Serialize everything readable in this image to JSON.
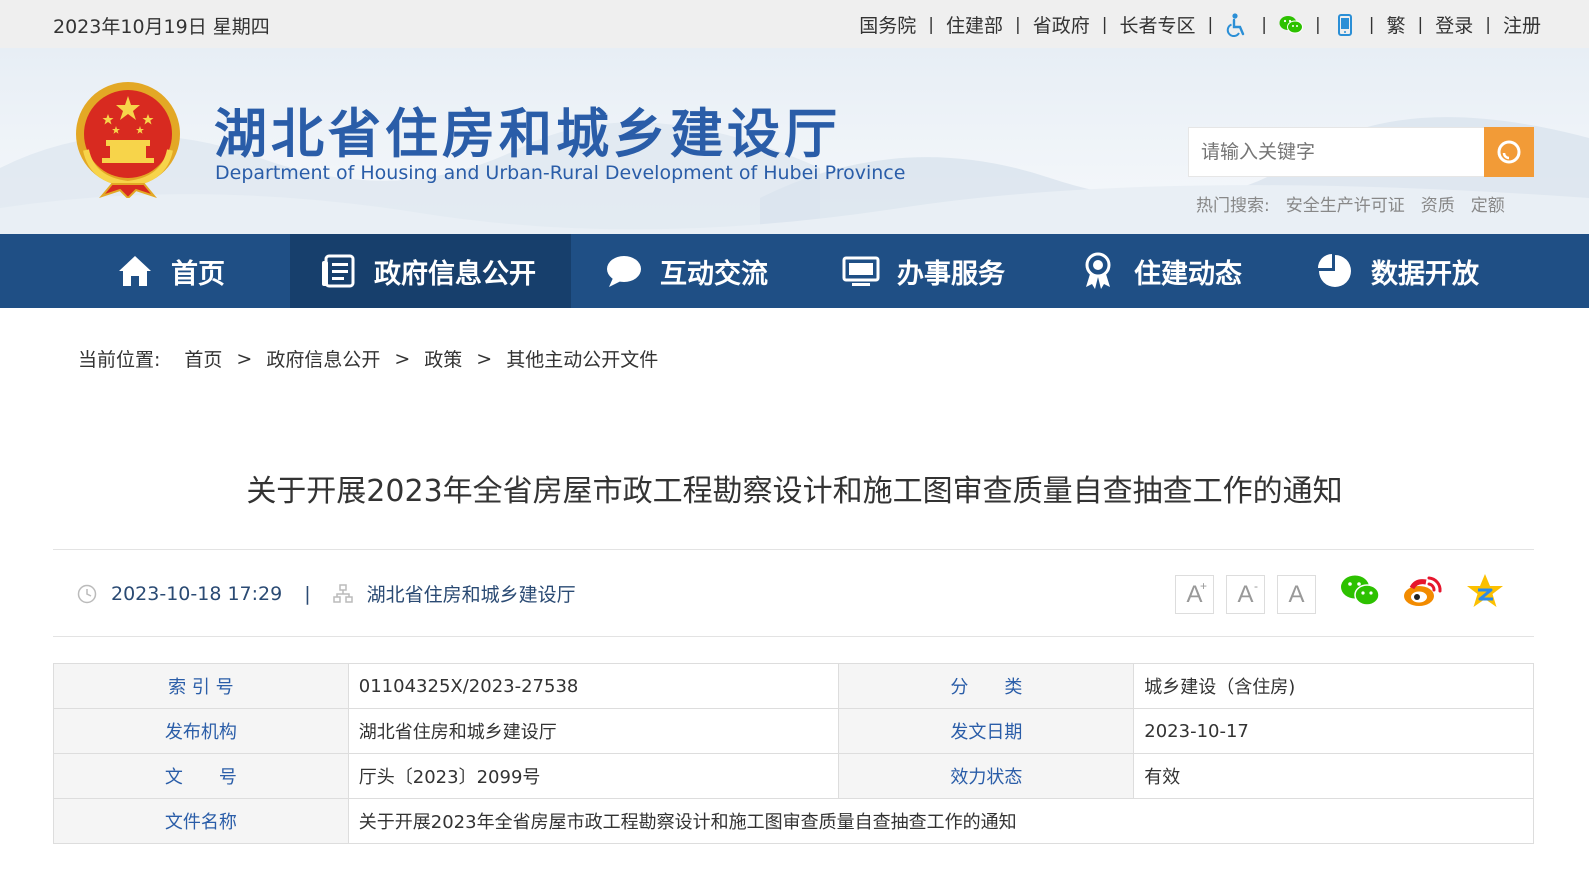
{
  "topbar": {
    "date": "2023年10月19日 星期四",
    "links": [
      "国务院",
      "住建部",
      "省政府",
      "长者专区"
    ],
    "right_links": [
      "繁",
      "登录",
      "注册"
    ],
    "icons": [
      "accessibility-icon",
      "wechat-icon",
      "mobile-icon"
    ]
  },
  "header": {
    "title": "湖北省住房和城乡建设厅",
    "subtitle": "Department of Housing and Urban-Rural Development of Hubei Province",
    "search_placeholder": "请输入关键字",
    "hot_label": "热门搜索:",
    "hot_terms": [
      "安全生产许可证",
      "资质",
      "定额"
    ]
  },
  "nav": {
    "items": [
      {
        "label": "首页",
        "icon": "home-icon"
      },
      {
        "label": "政府信息公开",
        "icon": "document-icon",
        "active": true
      },
      {
        "label": "互动交流",
        "icon": "chat-bubble-icon"
      },
      {
        "label": "办事服务",
        "icon": "monitor-icon"
      },
      {
        "label": "住建动态",
        "icon": "award-icon"
      },
      {
        "label": "数据开放",
        "icon": "pie-chart-icon"
      }
    ]
  },
  "breadcrumb": {
    "label": "当前位置:",
    "items": [
      "首页",
      "政府信息公开",
      "政策",
      "其他主动公开文件"
    ],
    "separator": ">"
  },
  "article": {
    "title": "关于开展2023年全省房屋市政工程勘察设计和施工图审查质量自查抽查工作的通知",
    "datetime": "2023-10-18 17:29",
    "source": "湖北省住房和城乡建设厅",
    "font_buttons": [
      "A",
      "A",
      "A"
    ],
    "share_icons": [
      "wechat-share-icon",
      "weibo-share-icon",
      "qzone-share-icon"
    ]
  },
  "info_table": {
    "rows": [
      {
        "l1": "索 引 号",
        "v1": "01104325X/2023-27538",
        "l2": "分　　类",
        "v2": "城乡建设（含住房)"
      },
      {
        "l1": "发布机构",
        "v1": "湖北省住房和城乡建设厅",
        "l2": "发文日期",
        "v2": "2023-10-17"
      },
      {
        "l1": "文　　号",
        "v1": "厅头〔2023〕2099号",
        "l2": "效力状态",
        "v2": "有效"
      }
    ],
    "name_label": "文件名称",
    "name_value": "关于开展2023年全省房屋市政工程勘察设计和施工图审查质量自查抽查工作的通知"
  },
  "colors": {
    "nav_bg": "#1f4f85",
    "nav_active": "#173f6c",
    "brand_blue": "#2a5da8",
    "search_btn": "#f29b37"
  }
}
